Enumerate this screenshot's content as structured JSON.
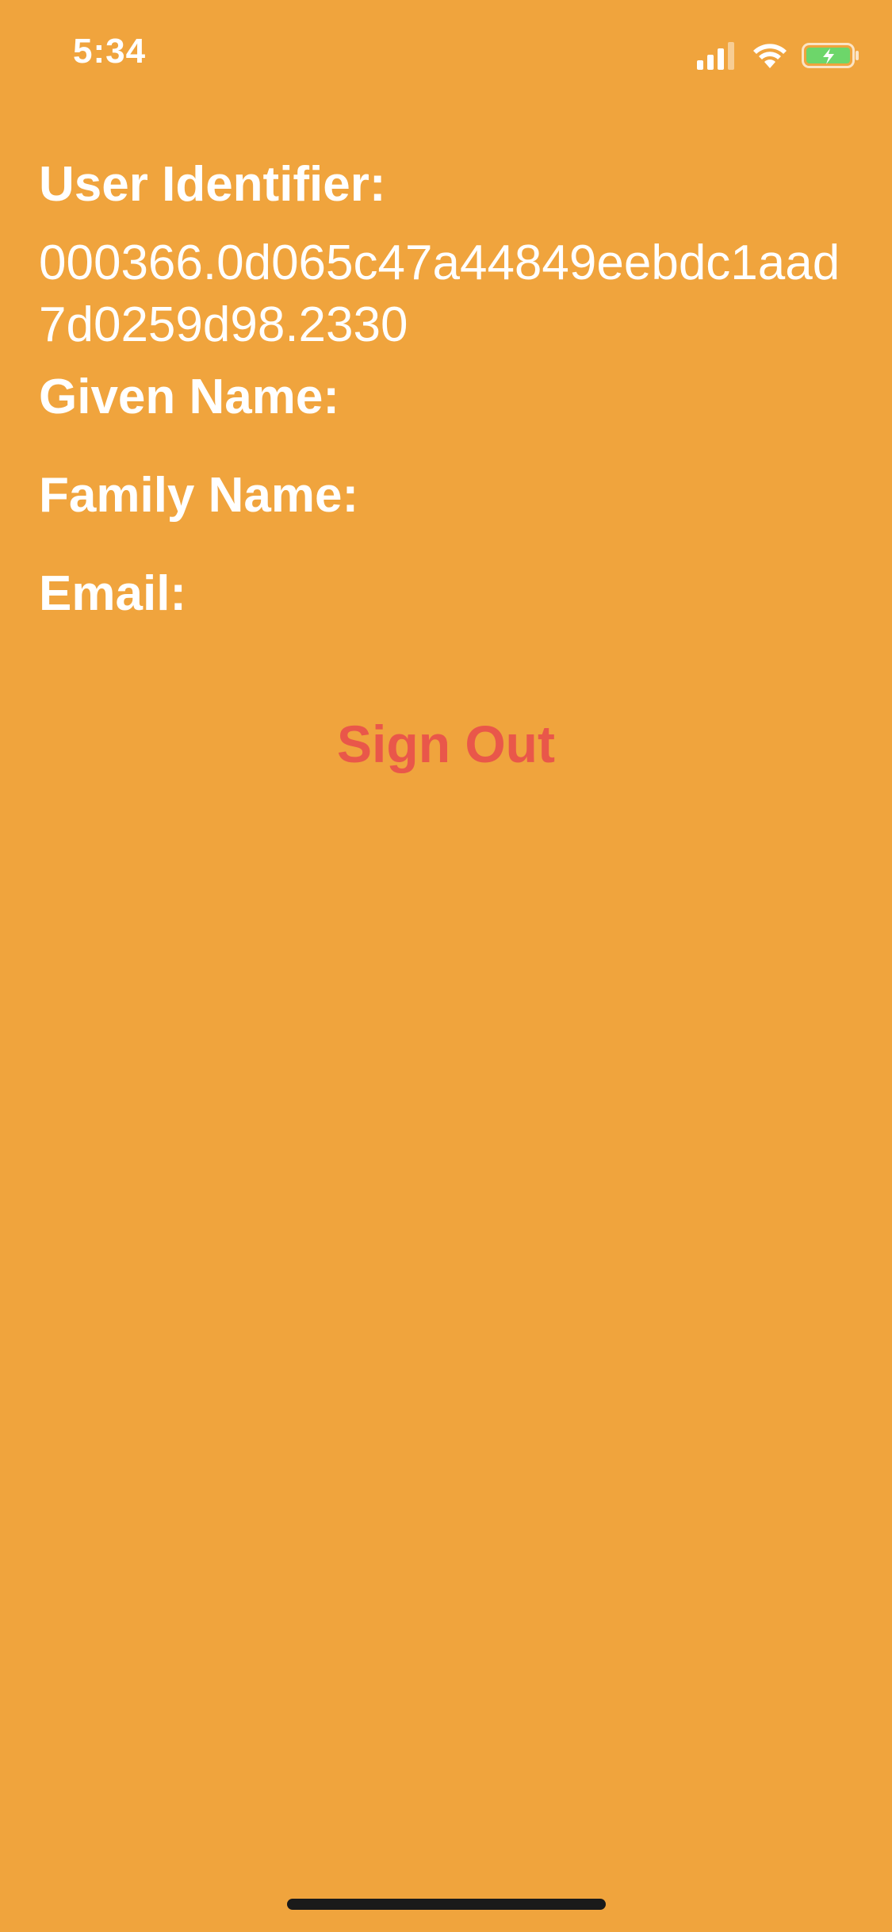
{
  "status_bar": {
    "time": "5:34",
    "signal_icon": "cellular-signal-icon",
    "wifi_icon": "wifi-icon",
    "battery_icon": "battery-charging-icon",
    "battery_fill_color": "#6DD66A"
  },
  "profile": {
    "user_identifier_label": "User Identifier:",
    "user_identifier_value": "000366.0d065c47a44849eebdc1aad7d0259d98.2330",
    "given_name_label": "Given Name:",
    "family_name_label": "Family Name:",
    "email_label": "Email:"
  },
  "actions": {
    "sign_out_label": "Sign Out",
    "sign_out_color": "#E9574A"
  },
  "theme": {
    "background": "#F0A43D",
    "text": "#FFFFFF"
  }
}
